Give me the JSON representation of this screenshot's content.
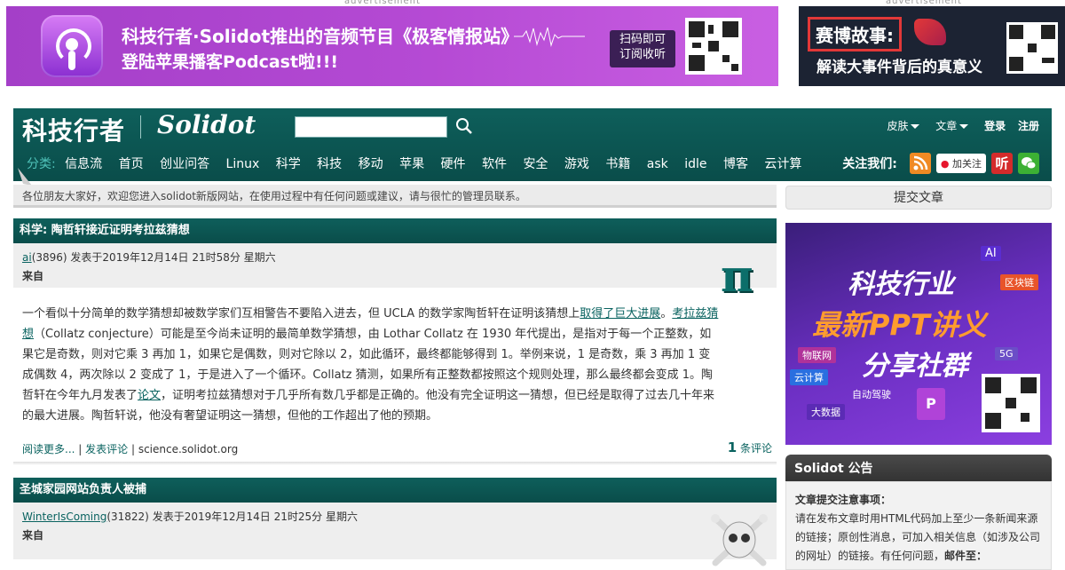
{
  "ads": {
    "label": "advertisement",
    "top_left": {
      "line1": "科技行者·Solidot推出的音频节目《极客情报站》",
      "line2": "登陆苹果播客Podcast啦!!!",
      "scan_text": "扫码即可\n订阅收听",
      "icon": "podcast-icon",
      "bg": "#b048d0"
    },
    "top_right": {
      "title": "赛博故事:",
      "subtitle": "解读大事件背后的真意义",
      "bg": "#1c2333"
    },
    "side": {
      "headline1": "科技行业",
      "headline2": "最新PPT讲义",
      "headline3": "分享社群",
      "tags": [
        "AI",
        "区块链",
        "物联网",
        "5G",
        "云计算",
        "自动驾驶",
        "大数据"
      ]
    }
  },
  "header": {
    "logo_cn": "科技行者",
    "logo_en": "Solidot",
    "search_placeholder": "",
    "skin": "皮肤",
    "article": "文章",
    "login": "登录",
    "register": "注册",
    "bg": "#0a4d4a"
  },
  "nav": {
    "category_label": "分类:",
    "items": [
      "信息流",
      "首页",
      "创业问答",
      "Linux",
      "科学",
      "科技",
      "移动",
      "苹果",
      "硬件",
      "软件",
      "安全",
      "游戏",
      "书籍",
      "ask",
      "idle",
      "博客",
      "云计算"
    ],
    "follow_label": "关注我们:",
    "weibo_follow": "加关注",
    "listen": "听"
  },
  "notice": "各位朋友大家好，欢迎您进入solidot新版网站，在使用过程中有任何问题或建议，请与很忙的管理员联系。",
  "sidebar": {
    "submit_label": "提交文章",
    "announce_title": "Solidot 公告",
    "announce_heading": "文章提交注意事项：",
    "announce_lines": [
      "请在发布文章时用HTML代码加上至少一条新闻来源",
      "的链接；原创性消息，可加入相关信息（如涉及公司",
      "的网址）的链接。有任何问题，",
      "邮件至："
    ]
  },
  "stories": [
    {
      "title": "科学: 陶哲轩接近证明考拉兹猜想",
      "author": "ai",
      "author_score": "(3896)",
      "posted": "发表于2019年12月14日 21时58分 星期六",
      "source_label": "来自",
      "icon": "pi-icon",
      "body": {
        "t1": "一个看似十分简单的数学猜想却被数学家们互相警告不要陷入进去，但 UCLA 的数学家陶哲轩在证明该猜想上",
        "a1": "取得了巨大进展",
        "t2": "。",
        "a2": "考拉兹猜想",
        "t3": "（Collatz conjecture）可能是至今尚未证明的最简单数学猜想，由 Lothar Collatz 在 1930 年代提出，是指对于每一个正整数，如果它是奇数，则对它乘 3 再加 1，如果它是偶数，则对它除以 2，如此循环，最终都能够得到 1。举例来说，1 是奇数，乘 3 再加 1 变成偶数 4，两次除以 2 变成了 1，于是进入了一个循环。Collatz 猜测，如果所有正整数都按照这个规则处理，那么最终都会变成 1。陶哲轩在今年九月发表了",
        "a3": "论文",
        "t4": "，证明考拉兹猜想对于几乎所有数几乎都是正确的。他没有完全证明这一猜想，但已经是取得了过去几十年来的最大进展。陶哲轩说，他没有奢望证明这一猜想，但他的工作超出了他的预期。"
      },
      "read_more": "阅读更多...",
      "sep": " | ",
      "post_comment": "发表评论",
      "domain": "science.solidot.org",
      "comment_count": "1",
      "comment_label": "条评论"
    },
    {
      "title": "圣城家园网站负责人被捕",
      "author": "WinterIsComing",
      "author_score": "(31822)",
      "posted": "发表于2019年12月14日 21时25分 星期六",
      "source_label": "来自",
      "icon": "skull-icon"
    }
  ]
}
